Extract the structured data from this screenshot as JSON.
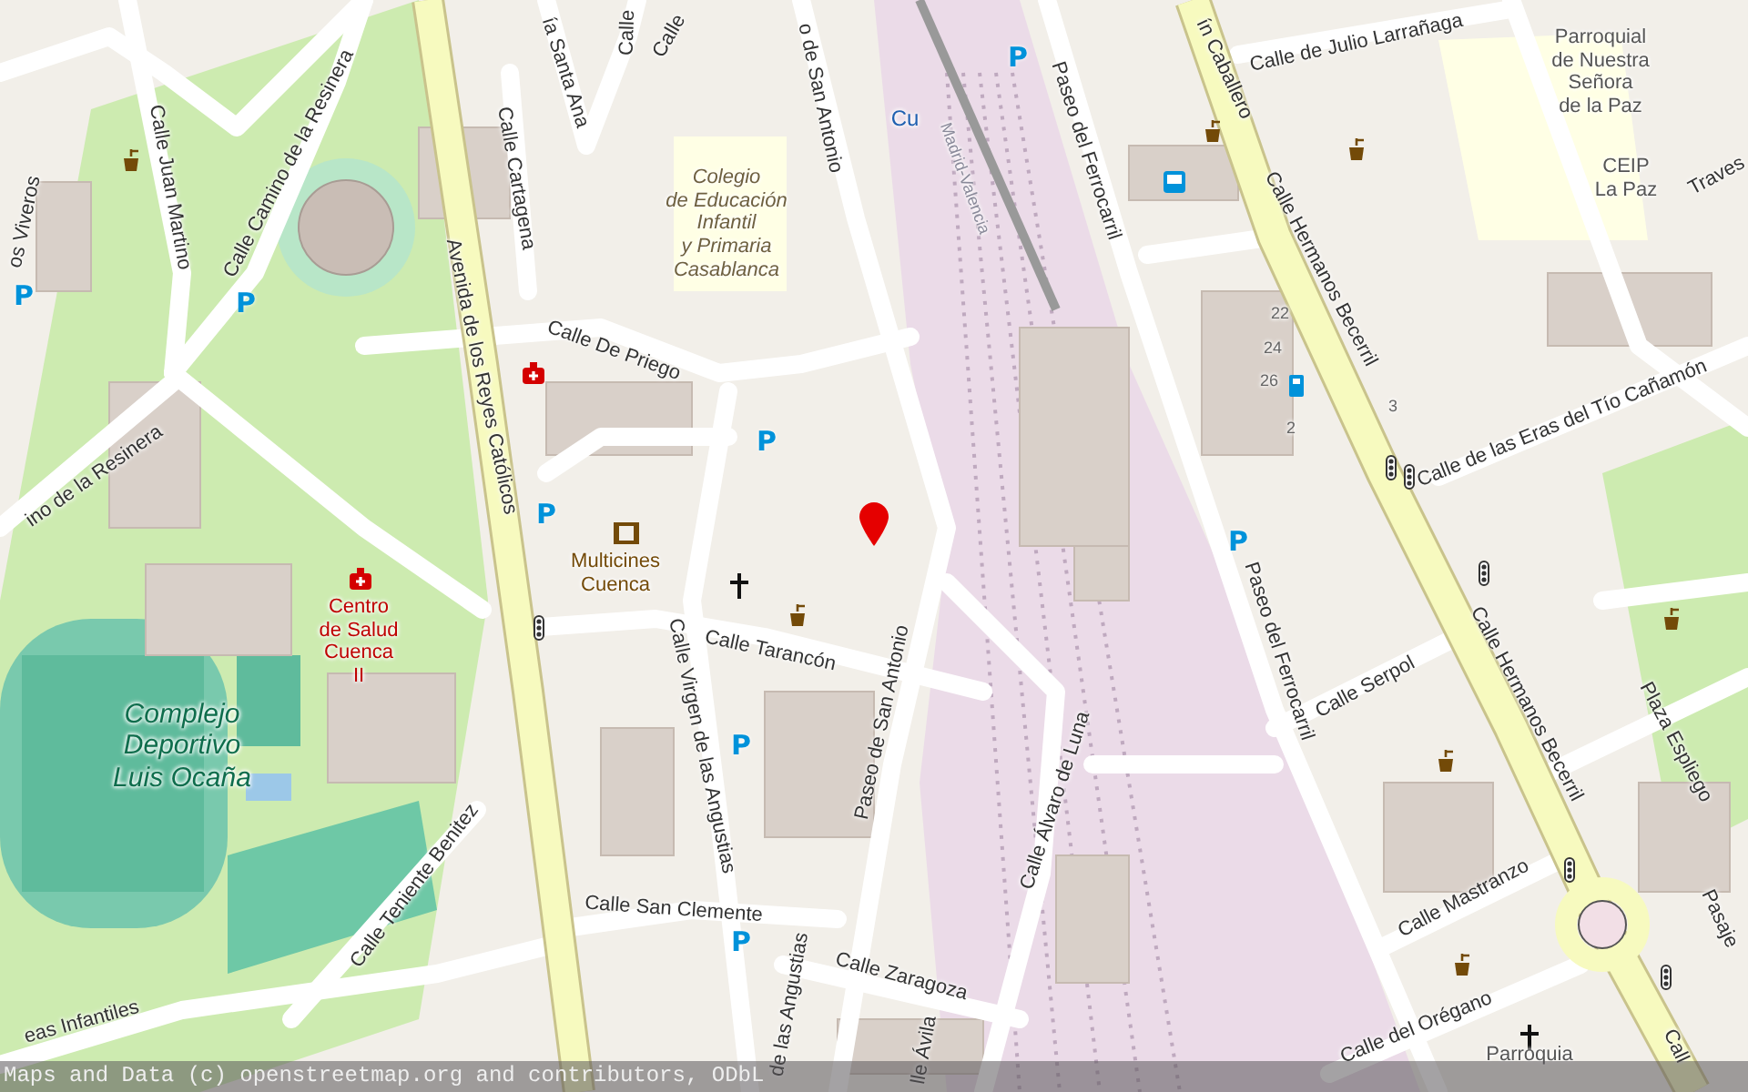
{
  "map": {
    "labels": [
      {
        "kind": "street",
        "text": "Calle Juan Martino"
      },
      {
        "kind": "street",
        "text": "Calle Camino de la Resinera"
      },
      {
        "kind": "street",
        "text": "os Viveros"
      },
      {
        "kind": "street",
        "text": "ino de la Resinera"
      },
      {
        "kind": "street",
        "text": "Calle Cartagena"
      },
      {
        "kind": "street",
        "text": "ía Santa Ana"
      },
      {
        "kind": "street",
        "text": "Calle"
      },
      {
        "kind": "street",
        "text": "Calle"
      },
      {
        "kind": "street",
        "text": "o de San Antonio"
      },
      {
        "kind": "street",
        "text": "Avenida de los Reyes Católicos"
      },
      {
        "kind": "street",
        "text": "Calle De Priego"
      },
      {
        "kind": "school",
        "lines": [
          "Colegio",
          "de Educación",
          "Infantil",
          "y Primaria",
          "Casablanca"
        ]
      },
      {
        "kind": "amenity",
        "lines": [
          "Multicines",
          "Cuenca"
        ]
      },
      {
        "kind": "health",
        "lines": [
          "Centro",
          "de Salud",
          "Cuenca",
          "II"
        ]
      },
      {
        "kind": "sports",
        "lines": [
          "Complejo",
          "Deportivo",
          "Luis Ocaña"
        ]
      },
      {
        "kind": "street",
        "text": "Calle Tarancón"
      },
      {
        "kind": "street",
        "text": "Calle Virgen de las Angustias"
      },
      {
        "kind": "street",
        "text": "Paseo de San Antonio"
      },
      {
        "kind": "street",
        "text": "Calle Álvaro de Luna"
      },
      {
        "kind": "street",
        "text": "Calle Teniente Benitez"
      },
      {
        "kind": "street",
        "text": "Calle San Clemente"
      },
      {
        "kind": "street",
        "text": "eas Infantiles"
      },
      {
        "kind": "street",
        "text": "de las Angustias"
      },
      {
        "kind": "street",
        "text": "Calle Zaragoza"
      },
      {
        "kind": "street",
        "text": "lle Ávila"
      },
      {
        "kind": "street",
        "text": "Paseo del Ferrocarril"
      },
      {
        "kind": "street",
        "text": "Paseo del Ferrocarril"
      },
      {
        "kind": "street",
        "text": "ín Caballero"
      },
      {
        "kind": "street",
        "text": "Calle de Julio Larrañaga"
      },
      {
        "kind": "building",
        "lines": [
          "Parroquial",
          "de Nuestra",
          "Señora",
          "de la Paz"
        ]
      },
      {
        "kind": "building",
        "lines": [
          "CEIP",
          "La Paz"
        ]
      },
      {
        "kind": "street",
        "text": "Traves"
      },
      {
        "kind": "street",
        "text": "Calle Hermanos Becerril"
      },
      {
        "kind": "street",
        "text": "Calle de las Eras del Tío Cañamón"
      },
      {
        "kind": "street",
        "text": "Calle Hermanos Becerril"
      },
      {
        "kind": "street",
        "text": "Calle Serpol"
      },
      {
        "kind": "street",
        "text": "Plaza Espliego"
      },
      {
        "kind": "street",
        "text": "Calle Mastranzo"
      },
      {
        "kind": "street",
        "text": "Calle del Orégano"
      },
      {
        "kind": "building",
        "lines": [
          "Parroquia"
        ]
      },
      {
        "kind": "street",
        "text": "Pasaje"
      },
      {
        "kind": "street",
        "text": "Call"
      },
      {
        "kind": "station",
        "text": "Cu"
      },
      {
        "kind": "rail",
        "text": "Madrid-Valencia"
      },
      {
        "kind": "housenumber",
        "text": "22"
      },
      {
        "kind": "housenumber",
        "text": "24"
      },
      {
        "kind": "housenumber",
        "text": "26"
      },
      {
        "kind": "housenumber",
        "text": "2"
      },
      {
        "kind": "housenumber",
        "text": "3"
      }
    ],
    "parking_signs": [
      "P",
      "P",
      "P",
      "P",
      "P",
      "P",
      "P",
      "P"
    ],
    "attribution": "Maps and Data (c) openstreetmap.org and contributors, ODbL"
  }
}
